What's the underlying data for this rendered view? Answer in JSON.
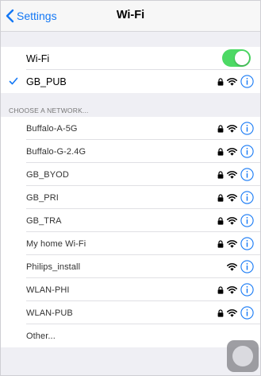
{
  "nav": {
    "back_label": "Settings",
    "title": "Wi-Fi"
  },
  "wifi_toggle": {
    "label": "Wi-Fi",
    "on": true
  },
  "connected": {
    "name": "GB_PUB",
    "locked": true
  },
  "networks_header": "CHOOSE A NETWORK...",
  "networks": [
    {
      "name": "Buffalo-A-5G",
      "locked": true
    },
    {
      "name": "Buffalo-G-2.4G",
      "locked": true
    },
    {
      "name": "GB_BYOD",
      "locked": true
    },
    {
      "name": "GB_PRI",
      "locked": true
    },
    {
      "name": "GB_TRA",
      "locked": true
    },
    {
      "name": "My home Wi-Fi",
      "locked": true
    },
    {
      "name": "Philips_install",
      "locked": false
    },
    {
      "name": "WLAN-PHI",
      "locked": true
    },
    {
      "name": "WLAN-PUB",
      "locked": true
    }
  ],
  "other_label": "Other...",
  "colors": {
    "accent": "#1478f5",
    "toggle_on": "#4cd964",
    "background": "#efeff4"
  },
  "icons": [
    "chevron-left-icon",
    "checkmark-icon",
    "lock-icon",
    "wifi-icon",
    "info-icon"
  ]
}
